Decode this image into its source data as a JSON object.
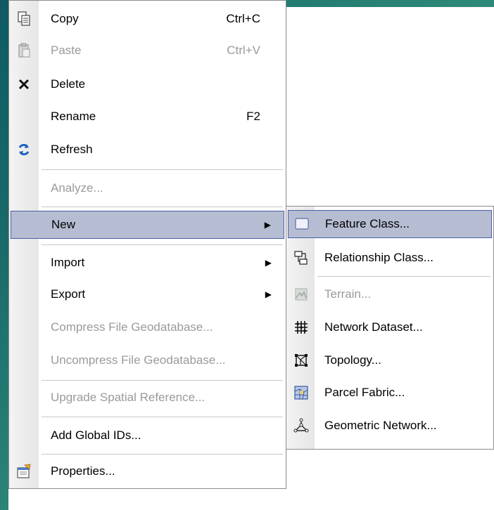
{
  "main_menu": {
    "items": [
      {
        "label": "Copy",
        "shortcut": "Ctrl+C",
        "icon": "copy-icon"
      },
      {
        "label": "Paste",
        "shortcut": "Ctrl+V",
        "icon": "paste-icon",
        "disabled": true
      },
      {
        "label": "Delete",
        "icon": "delete-icon"
      },
      {
        "label": "Rename",
        "shortcut": "F2"
      },
      {
        "label": "Refresh",
        "icon": "refresh-icon"
      },
      {
        "label": "Analyze...",
        "disabled": true
      },
      {
        "label": "New",
        "submenu": true,
        "active": true
      },
      {
        "label": "Import",
        "submenu": true
      },
      {
        "label": "Export",
        "submenu": true
      },
      {
        "label": "Compress File Geodatabase...",
        "disabled": true
      },
      {
        "label": "Uncompress File Geodatabase...",
        "disabled": true
      },
      {
        "label": "Upgrade Spatial Reference...",
        "disabled": true
      },
      {
        "label": "Add Global IDs..."
      },
      {
        "label": "Properties...",
        "icon": "properties-icon"
      }
    ]
  },
  "sub_menu": {
    "items": [
      {
        "label": "Feature Class...",
        "icon": "feature-class-icon",
        "active": true
      },
      {
        "label": "Relationship Class...",
        "icon": "relationship-class-icon"
      },
      {
        "label": "Terrain...",
        "icon": "terrain-icon",
        "disabled": true
      },
      {
        "label": "Network Dataset...",
        "icon": "network-dataset-icon"
      },
      {
        "label": "Topology...",
        "icon": "topology-icon"
      },
      {
        "label": "Parcel Fabric...",
        "icon": "parcel-fabric-icon"
      },
      {
        "label": "Geometric Network...",
        "icon": "geometric-network-icon"
      }
    ]
  },
  "colors": {
    "highlight": "#b6bdd2",
    "highlight_border": "#4a5fa6",
    "disabled_text": "#9a9a9a"
  }
}
